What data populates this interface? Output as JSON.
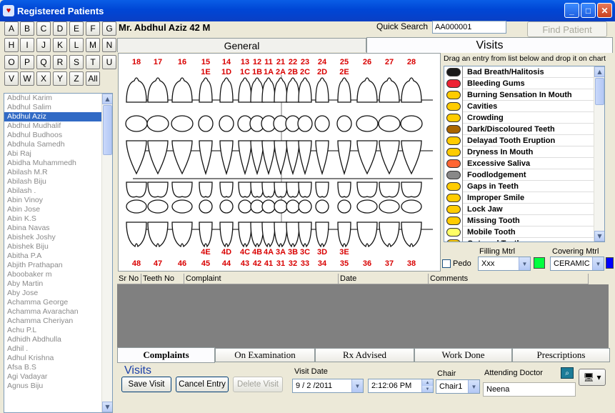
{
  "window": {
    "title": "Registered Patients"
  },
  "alphabet": [
    "A",
    "B",
    "C",
    "D",
    "E",
    "F",
    "G",
    "H",
    "I",
    "J",
    "K",
    "L",
    "M",
    "N",
    "O",
    "P",
    "Q",
    "R",
    "S",
    "T",
    "U",
    "V",
    "W",
    "X",
    "Y",
    "Z",
    "All"
  ],
  "patients": [
    "Abdhul Karim",
    "Abdhul Salim",
    "Abdhul Aziz",
    "Abdhul Mudhalif",
    "Abdhul Budhoos",
    "Abdhula Samedh",
    "Abi Raj",
    "Abidha Muhammedh",
    "Abilash M.R",
    "Abilash Biju",
    "Abilash .",
    "Abin Vinoy",
    "Abin Jose",
    "Abin K.S",
    "Abina Navas",
    "Abishek Joshy",
    "Abishek Biju",
    "Abitha P.A",
    "Abjith Prathapan",
    "Aboobaker m",
    "Aby Martin",
    "Aby Jose",
    "Achamma George",
    "Achamma Avarachan",
    "Achamma Cheriyan",
    "Achu P.L",
    "Adhidh Abdhulla",
    "Adhil .",
    "Adhul Krishna",
    "Afsa B.S",
    "Agi Vadayar",
    "Agnus Biju"
  ],
  "selected_patient": "Abdhul Aziz",
  "header": {
    "patient_label": "Mr. Abdhul  Aziz 42 M",
    "quick_search_label": "Quick Search",
    "quick_search_value": "AA000001",
    "find_label": "Find Patient"
  },
  "tabs_top": {
    "general": "General",
    "visits": "Visits"
  },
  "chart": {
    "top_numbers": [
      "18",
      "17",
      "16",
      "15",
      "14",
      "13",
      "12",
      "11",
      "21",
      "22",
      "23",
      "24",
      "25",
      "26",
      "27",
      "28"
    ],
    "top_sub": [
      "1E",
      "1D",
      "1C",
      "1B",
      "1A",
      "2A",
      "2B",
      "2C",
      "2D",
      "2E"
    ],
    "bottom_sub": [
      "4E",
      "4D",
      "4C",
      "4B",
      "4A",
      "3A",
      "3B",
      "3C",
      "3D",
      "3E"
    ],
    "bottom_numbers": [
      "48",
      "47",
      "46",
      "45",
      "44",
      "43",
      "42",
      "41",
      "31",
      "32",
      "33",
      "34",
      "35",
      "36",
      "37",
      "38"
    ]
  },
  "complaints_panel": {
    "hint": "Drag an entry from list below and drop it on chart",
    "items": [
      "Bad Breath/Halitosis",
      "Bleeding Gums",
      "Burning Sensation In Mouth",
      "Cavities",
      "Crowding",
      "Dark/Discoloured Teeth",
      "Delayad Tooth Eruption",
      "Dryness In Mouth",
      "Excessive Saliva",
      "Foodlodgement",
      "Gaps in Teeth",
      "Improper Smile",
      "Lock Jaw",
      "Missing  Tooth",
      "Mobile Tooth",
      "Outward Teeth"
    ],
    "pedo_label": "Pedo",
    "filling_label": "Filling Mtrl",
    "filling_value": "Xxx",
    "covering_label": "Covering Mtrl",
    "covering_value": "CERAMIC"
  },
  "grid": {
    "headers": [
      "Sr No",
      "Teeth No",
      "Complaint",
      "Date",
      "Comments"
    ]
  },
  "bottom_tabs": [
    "Complaints",
    "On Examination",
    "Rx Advised",
    "Work Done",
    "Prescriptions"
  ],
  "visits": {
    "title": "Visits",
    "save": "Save Visit",
    "cancel": "Cancel Entry",
    "delete": "Delete Visit",
    "visit_date_label": "Visit Date",
    "date": "9 / 2 /2011",
    "time": "2:12:06 PM",
    "chair_label": "Chair",
    "chair_value": "Chair1",
    "doctor_label": "Attending Doctor",
    "doctor_value": "Neena"
  },
  "colors": {
    "titlebar": "#0046d5",
    "tooth_number": "#d90000",
    "filling_swatch": "#00ff40",
    "covering_swatch": "#0000ff",
    "selected": "#316ac5"
  }
}
